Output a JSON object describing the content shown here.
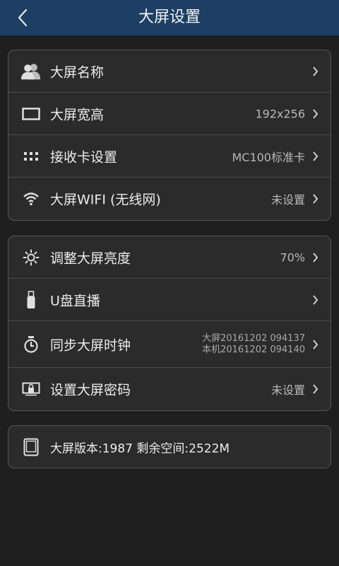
{
  "header": {
    "title": "大屏设置",
    "back_icon": "back-chevron-icon"
  },
  "group1": [
    {
      "icon": "users-icon",
      "label": "大屏名称",
      "value": ""
    },
    {
      "icon": "screen-rect-icon",
      "label": "大屏宽高",
      "value": "192x256"
    },
    {
      "icon": "grid-dots-icon",
      "label": "接收卡设置",
      "value": "MC100标准卡"
    },
    {
      "icon": "wifi-icon",
      "label": "大屏WIFI (无线网)",
      "value": "未设置"
    }
  ],
  "group2": [
    {
      "icon": "brightness-icon",
      "label": "调整大屏亮度",
      "value": "70%"
    },
    {
      "icon": "usb-drive-icon",
      "label": "U盘直播",
      "value": ""
    },
    {
      "icon": "stopwatch-icon",
      "label": "同步大屏时钟",
      "value_line1": "大屏20161202 094137",
      "value_line2": "本机20161202 094140"
    },
    {
      "icon": "lock-screen-icon",
      "label": "设置大屏密码",
      "value": "未设置"
    }
  ],
  "info": {
    "icon": "device-icon",
    "text": "大屏版本:1987 剩余空间:2522M"
  },
  "colors": {
    "header_bg": "#1d3f63",
    "page_bg": "#1f1f1f",
    "card_bg": "#2b2b2b",
    "card_border": "#555555"
  }
}
